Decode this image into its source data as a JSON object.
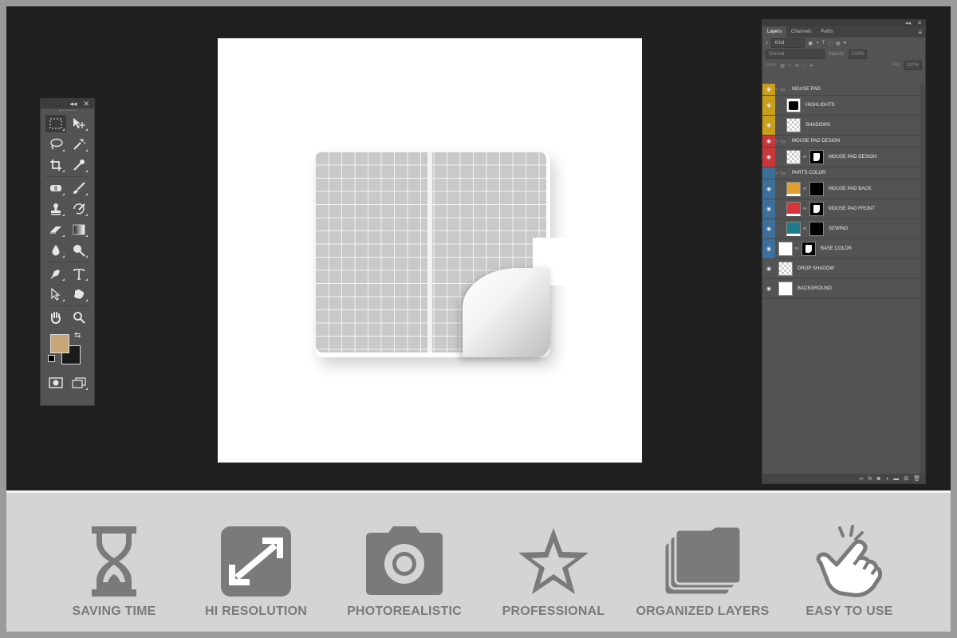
{
  "toolbox": {
    "header": {
      "collapse": "◂◂",
      "close": "✕"
    },
    "rows": [
      [
        "marquee-tool",
        "move-tool"
      ],
      [
        "lasso-tool",
        "magic-wand-tool"
      ],
      [
        "crop-tool",
        "eyedropper-tool"
      ],
      [
        "spot-healing-tool",
        "brush-tool"
      ],
      [
        "clone-stamp-tool",
        "history-brush-tool"
      ],
      [
        "eraser-tool",
        "gradient-tool"
      ],
      [
        "blur-tool",
        "dodge-tool"
      ],
      [
        "pen-tool",
        "type-tool"
      ],
      [
        "path-selection-tool",
        "shape-tool"
      ],
      [
        "hand-tool",
        "zoom-tool"
      ]
    ],
    "foreground_color": "#c8a576",
    "background_color": "#1a1a1a",
    "swap_glyph": "⇆"
  },
  "layers_panel": {
    "tabs": [
      "Layers",
      "Channels",
      "Paths"
    ],
    "active_tab": "Layers",
    "filter": "Kind",
    "blend_mode": "Normal",
    "opacity_label": "Opacity:",
    "opacity_value": "100%",
    "lock_label": "Lock:",
    "fill_label": "Fill:",
    "fill_value": "100%",
    "layers": [
      {
        "type": "group",
        "name": "MOUSE PAD",
        "color": "yellow",
        "visible": true
      },
      {
        "type": "layer",
        "name": "HIGHLIGHTS",
        "color": "yellow",
        "visible": true,
        "thumb": "hl",
        "indent": 1
      },
      {
        "type": "layer",
        "name": "SHADOWS",
        "color": "yellow",
        "visible": true,
        "thumb": "check",
        "indent": 1
      },
      {
        "type": "group",
        "name": "MOUSE PAD DESIGN",
        "color": "red",
        "visible": true
      },
      {
        "type": "layer",
        "name": "MOUSE PAD DESIGN",
        "color": "red",
        "visible": true,
        "thumb": "check",
        "mask": true,
        "indent": 1
      },
      {
        "type": "group",
        "name": "PARTS COLOR",
        "color": "blue",
        "visible": false
      },
      {
        "type": "layer",
        "name": "MOUSE PAD BACK",
        "color": "blue",
        "visible": true,
        "swatch": "#e2a12e",
        "mask": "black",
        "indent": 1
      },
      {
        "type": "layer",
        "name": "MOUSE PAD FRONT",
        "color": "blue",
        "visible": true,
        "swatch": "#d8353a",
        "mask": true,
        "indent": 1
      },
      {
        "type": "layer",
        "name": "SEWING",
        "color": "blue",
        "visible": true,
        "swatch": "#1d7c8c",
        "mask": "black",
        "indent": 1
      },
      {
        "type": "layer",
        "name": "BASE COLOR",
        "color": "blue",
        "visible": true,
        "thumb": "white",
        "mask": true,
        "indent": 0
      },
      {
        "type": "layer",
        "name": "DROP SHADOW",
        "color": "none",
        "visible": true,
        "thumb": "check",
        "indent": 0
      },
      {
        "type": "layer",
        "name": "BACKGROUND",
        "color": "none",
        "visible": true,
        "thumb": "white",
        "indent": 0
      }
    ]
  },
  "features": [
    {
      "label": "SAVING TIME",
      "icon": "hourglass-icon"
    },
    {
      "label": "HI RESOLUTION",
      "icon": "expand-arrows-icon"
    },
    {
      "label": "PHOTOREALISTIC",
      "icon": "camera-icon"
    },
    {
      "label": "PROFESSIONAL",
      "icon": "star-icon"
    },
    {
      "label": "ORGANIZED LAYERS",
      "icon": "stacked-folders-icon"
    },
    {
      "label": "EASY TO USE",
      "icon": "pointing-hand-icon"
    }
  ],
  "colors": {
    "workspace": "#202020",
    "panel": "#535353",
    "strip": "#d4d4d4",
    "icon_gray": "#7a7a7a"
  }
}
